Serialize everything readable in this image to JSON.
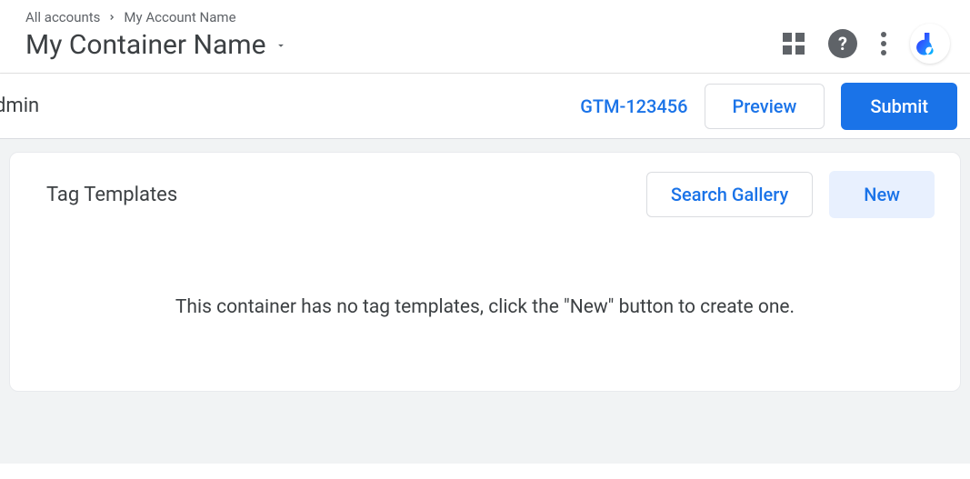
{
  "header": {
    "breadcrumb": {
      "parent": "All accounts",
      "current": "My Account Name"
    },
    "container_title": "My Container Name"
  },
  "subbar": {
    "left_label": "dmin",
    "container_id": "GTM-123456",
    "preview_label": "Preview",
    "submit_label": "Submit"
  },
  "panel": {
    "title": "Tag Templates",
    "search_label": "Search Gallery",
    "new_label": "New",
    "empty_message": "This container has no tag templates, click the \"New\" button to create one."
  }
}
